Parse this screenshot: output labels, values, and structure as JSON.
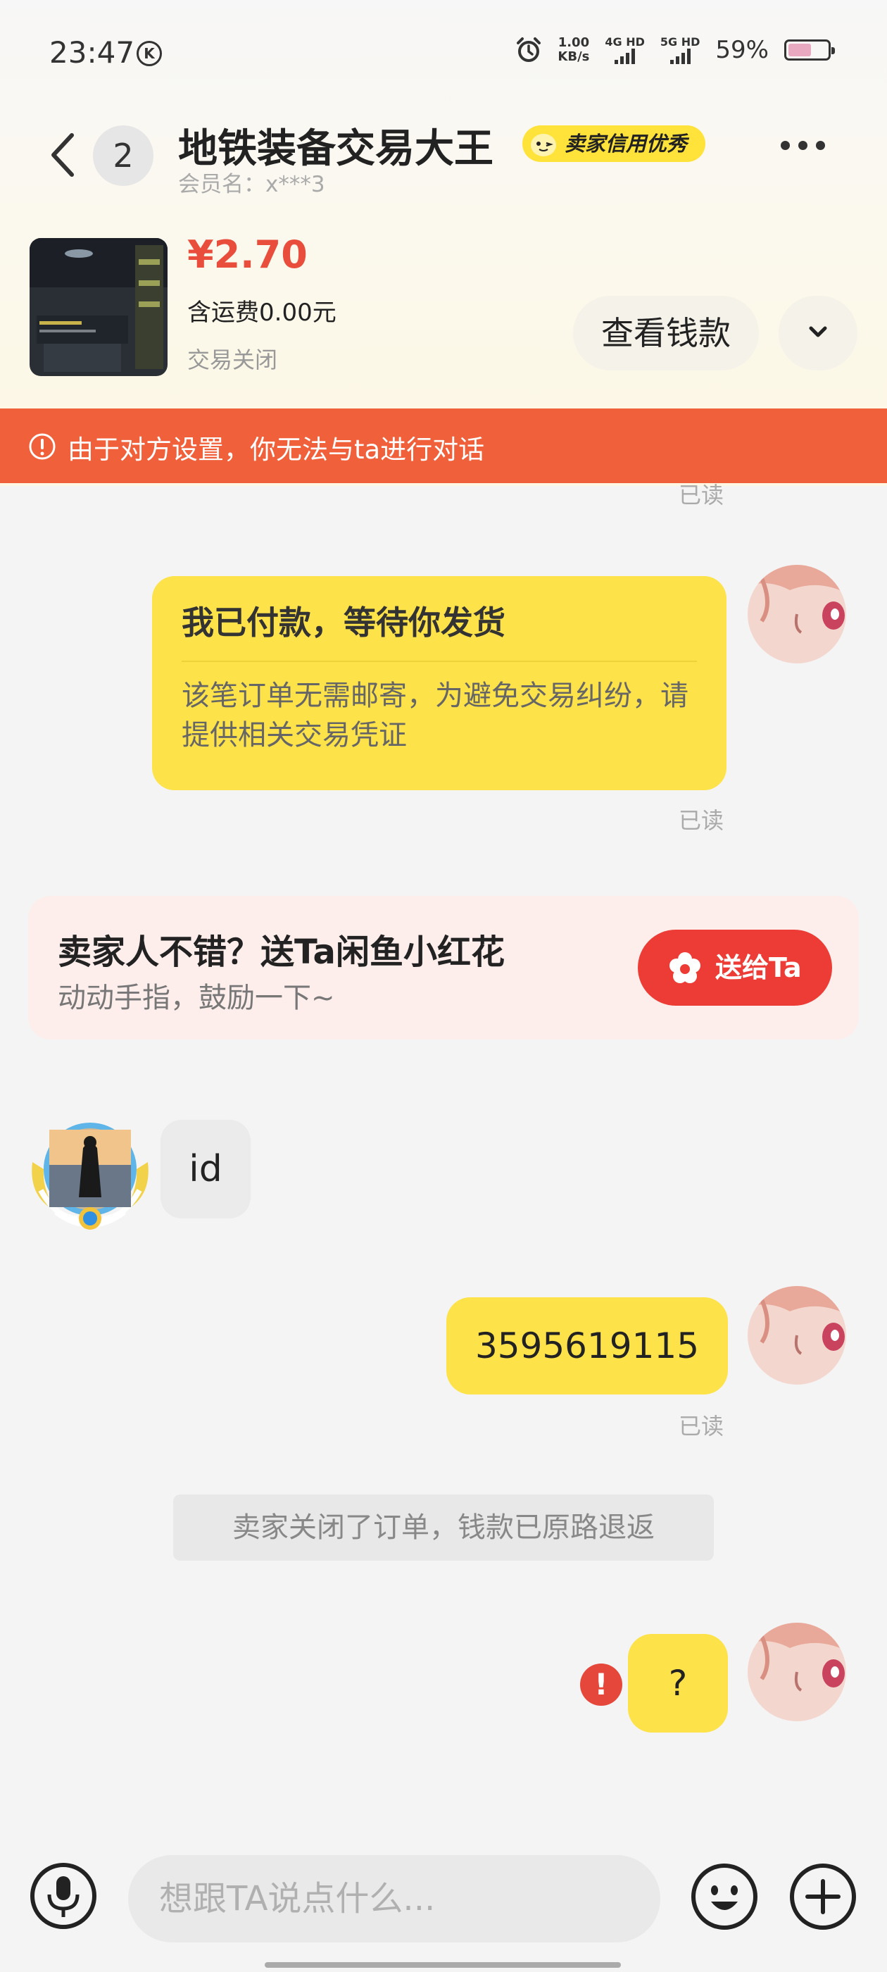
{
  "status_bar": {
    "time": "23:47",
    "k_badge": "K",
    "speed_value": "1.00",
    "speed_unit": "KB/s",
    "sim1_label": "4G HD",
    "sim2_label": "5G HD",
    "battery_pct": "59%",
    "battery_level": 0.59
  },
  "header": {
    "back_icon": "chevron-left-icon",
    "unread_count": "2",
    "shop_name": "地铁装备交易大王",
    "credit_badge": "卖家信用优秀",
    "member_label": "会员名：x***3",
    "more_icon": "more-dots-icon"
  },
  "product": {
    "price": "¥2.70",
    "shipping": "含运费0.00元",
    "status": "交易关闭",
    "view_money_label": "查看钱款",
    "expand_icon": "chevron-down-icon"
  },
  "warning": {
    "text": "由于对方设置，你无法与ta进行对话",
    "color": "#f0603b"
  },
  "messages": {
    "top_read": "已读",
    "payment_card": {
      "title": "我已付款，等待你发货",
      "body": "该笔订单无需邮寄，为避免交易纠纷，请提供相关交易凭证",
      "read": "已读"
    },
    "promo": {
      "title": "卖家人不错？送Ta闲鱼小红花",
      "subtitle": "动动手指，鼓励一下~",
      "button": "送给Ta"
    },
    "seller_msg": "id",
    "reply_msg": "3595619115",
    "reply_read": "已读",
    "system_msg": "卖家关闭了订单，钱款已原路退返",
    "failed_msg": "?",
    "failed_icon": "!"
  },
  "input_bar": {
    "placeholder": "想跟TA说点什么...",
    "mic_icon": "microphone-icon",
    "emoji_icon": "emoji-icon",
    "plus_icon": "plus-icon"
  },
  "colors": {
    "accent_yellow": "#fde24a",
    "price_red": "#e94d3b",
    "gift_red": "#ec3c35"
  }
}
